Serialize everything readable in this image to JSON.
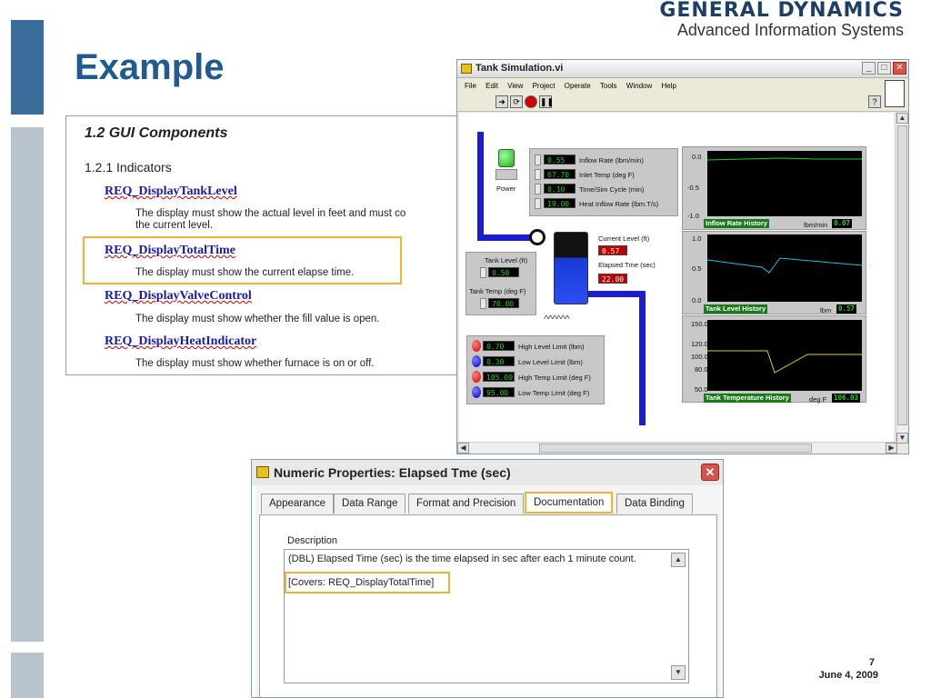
{
  "brand": {
    "name": "GENERAL DYNAMICS",
    "sub": "Advanced Information Systems"
  },
  "slide": {
    "title": "Example",
    "page_number": "7",
    "date": "June 4, 2009"
  },
  "doc": {
    "section": "1.2  GUI Components",
    "subsection": "1.2.1  Indicators",
    "requirements": [
      {
        "id": "REQ_DisplayTankLevel",
        "desc_line1": "The display must show the actual level in feet and must co",
        "desc_line2": "the current level."
      },
      {
        "id": "REQ_DisplayTotalTime",
        "desc_line1": "The display must show the current elapse time.",
        "desc_line2": ""
      },
      {
        "id": "REQ_DisplayValveControl",
        "desc_line1": "The display must show whether the fill value is open.",
        "desc_line2": ""
      },
      {
        "id": "REQ_DisplayHeatIndicator",
        "desc_line1": "The display must show whether furnace is on or off.",
        "desc_line2": ""
      }
    ]
  },
  "lv": {
    "title": "Tank Simulation.vi",
    "menu": [
      "File",
      "Edit",
      "View",
      "Project",
      "Operate",
      "Tools",
      "Window",
      "Help"
    ],
    "power_label": "Power",
    "inputs": [
      {
        "value": "0.55",
        "label": "Inflow Rate (lbm/min)"
      },
      {
        "value": "67.70",
        "label": "Inlet Temp (deg F)"
      },
      {
        "value": "0.10",
        "label": "Time/Sim Cycle (min)"
      },
      {
        "value": "19.00",
        "label": "Heat Inflow Rate (lbm.T/s)"
      }
    ],
    "tank_level_label": "Tank Level (ft)",
    "tank_level_value": "0.50",
    "tank_temp_label": "Tank Temp (deg F)",
    "tank_temp_value": "70.00",
    "current_level_label": "Current Level (ft)",
    "current_level_value": "0.57",
    "elapsed_label": "Elapsed Tme (sec)",
    "elapsed_value": "22.00",
    "limits": [
      {
        "value": "0.70",
        "label": "High Level Limit (lbm)",
        "color": "red"
      },
      {
        "value": "0.30",
        "label": "Low Level Limit (lbm)",
        "color": "blue"
      },
      {
        "value": "105.00",
        "label": "High Temp Limit (deg F)",
        "color": "red"
      },
      {
        "value": "95.00",
        "label": "Low Temp Limit (deg F)",
        "color": "blue"
      }
    ],
    "charts": [
      {
        "caption": "Inflow Rate History",
        "unit": "lbm/min",
        "value": "0.07",
        "ticks": [
          "0.0",
          "-0.5",
          "-1.0"
        ],
        "line_color": "#1bd11b"
      },
      {
        "caption": "Tank Level History",
        "unit": "lbm",
        "value": "0.57",
        "ticks": [
          "1.0",
          "0.5",
          "0.0"
        ],
        "line_color": "#19c7d6"
      },
      {
        "caption": "Tank Temperature History",
        "unit": "deg F",
        "value": "106.03",
        "ticks": [
          "150.0",
          "120.0",
          "100.0",
          "80.0",
          "50.0"
        ],
        "line_color": "#e0d020"
      }
    ]
  },
  "dialog": {
    "title": "Numeric Properties: Elapsed Tme (sec)",
    "tabs": [
      "Appearance",
      "Data Range",
      "Format and Precision",
      "Documentation",
      "Data Binding"
    ],
    "active_tab": "Documentation",
    "description_label": "Description",
    "description_line1": "(DBL) Elapsed Time (sec) is the time elapsed in sec after each 1 minute count.",
    "description_line2": "[Covers: REQ_DisplayTotalTime]"
  },
  "colors": {
    "accent_highlight": "#f2b233",
    "title_blue": "#1f5b8e",
    "pipe_blue": "#1b1bcf"
  }
}
